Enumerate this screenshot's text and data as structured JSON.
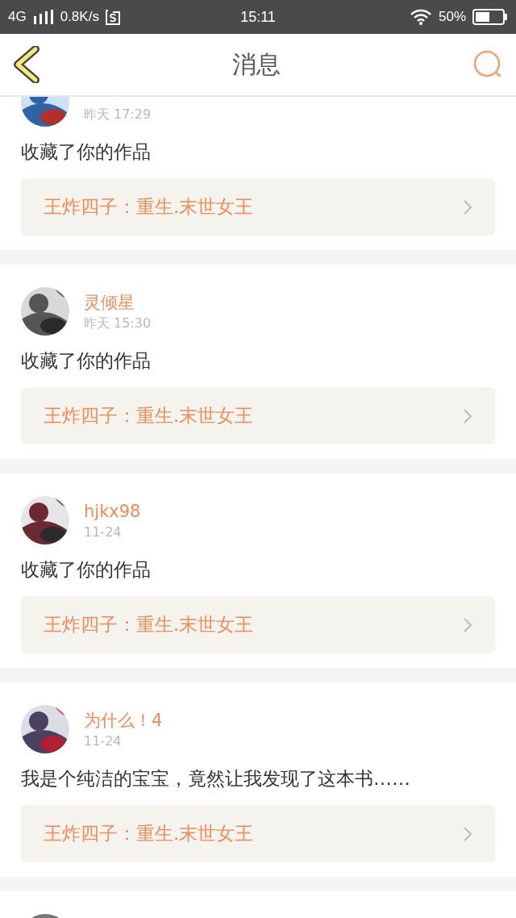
{
  "status_bar": {
    "network": "4G",
    "speed": "0.8K/s",
    "time": "15:11",
    "battery": "50%"
  },
  "header": {
    "title": "消息"
  },
  "messages": [
    {
      "avatar": {
        "kind": "picture"
      },
      "time": "昨天 17:29",
      "text": "收藏了你的作品",
      "work": "王炸四子：重生.末世女王"
    },
    {
      "avatar": {
        "kind": "picture"
      },
      "name": "灵倾星",
      "time": "昨天 15:30",
      "text": "收藏了你的作品",
      "work": "王炸四子：重生.末世女王"
    },
    {
      "avatar": {
        "kind": "picture"
      },
      "name": "hjkx98",
      "time": "11-24",
      "text": "收藏了你的作品",
      "work": "王炸四子：重生.末世女王"
    },
    {
      "avatar": {
        "kind": "picture"
      },
      "name": "为什么！4",
      "time": "11-24",
      "text": "我是个纯洁的宝宝，竟然让我发现了这本书……",
      "work": "王炸四子：重生.末世女王"
    },
    {
      "avatar": {
        "kind": "picture"
      }
    }
  ]
}
